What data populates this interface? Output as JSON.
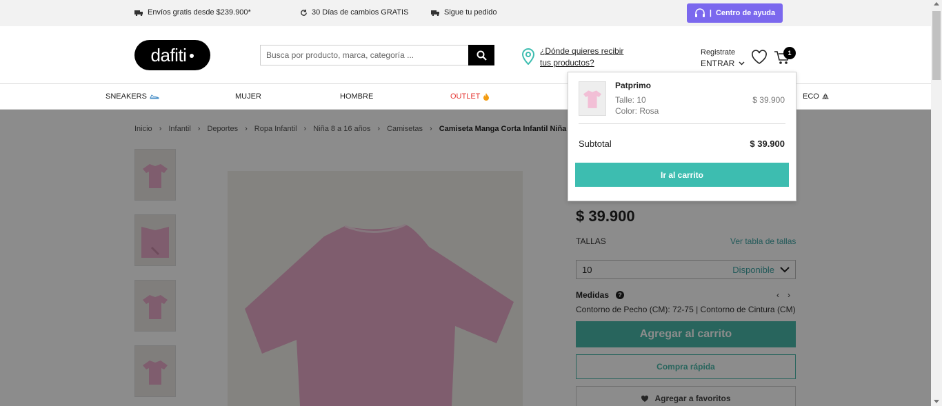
{
  "promos": [
    {
      "label": "Envíos gratis desde $239.900*",
      "icon": "truck-icon"
    },
    {
      "label": "30 Días de cambios GRATIS",
      "icon": "refresh-icon"
    },
    {
      "label": "Sigue tu pedido",
      "icon": "truck-icon"
    }
  ],
  "help": {
    "label": "Centro de ayuda",
    "separator": "|",
    "icon": "headset-icon"
  },
  "header": {
    "logo_text": "dafiti",
    "search_placeholder": "Busca por producto, marca, categoría ...",
    "location_link": "¿Dónde quieres recibir tus productos?",
    "account_register": "Registrate",
    "account_login": "ENTRAR",
    "cart_count": "1"
  },
  "nav": [
    {
      "label": "SNEAKERS",
      "icon": "sneaker-icon"
    },
    {
      "label": "MUJER"
    },
    {
      "label": "HOMBRE"
    },
    {
      "label": "OUTLET",
      "icon": "fire-icon"
    },
    {
      "label": "ECO",
      "icon": "recycle-icon"
    }
  ],
  "breadcrumbs": [
    "Inicio",
    "Infantil",
    "Deportes",
    "Ropa Infantil",
    "Niña 8 a 16 años",
    "Camisetas",
    "Camiseta Manga Corta Infantil Niña"
  ],
  "product": {
    "price": "$ 39.900",
    "sizes_label": "TALLAS",
    "size_guide": "Ver tabla de tallas",
    "selected_size": "10",
    "availability": "Disponible",
    "medidas_label": "Medidas",
    "medidas_help": "?",
    "medidas_text": "Contorno de Pecho (CM): 72-75 | Contorno de Cintura (CM)",
    "add_to_cart": "Agregar al carrito",
    "quick_buy": "Compra rápida",
    "add_fav": "Agregar a favoritos"
  },
  "minicart": {
    "brand": "Patprimo",
    "size": "Talle: 10",
    "color": "Color: Rosa",
    "price": "$ 39.900",
    "subtotal_label": "Subtotal",
    "subtotal_value": "$ 39.900",
    "button": "Ir al carrito"
  },
  "colors": {
    "accent": "#49b9a9",
    "help_purple": "#7b68ee",
    "product_pink": "#e8a9c8"
  }
}
